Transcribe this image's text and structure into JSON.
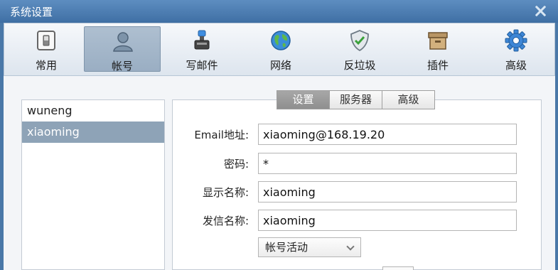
{
  "window": {
    "title": "系统设置"
  },
  "toolbar": {
    "items": [
      {
        "label": "常用",
        "icon": "switch-icon"
      },
      {
        "label": "帐号",
        "icon": "user-icon"
      },
      {
        "label": "写邮件",
        "icon": "compose-icon"
      },
      {
        "label": "网络",
        "icon": "globe-icon"
      },
      {
        "label": "反垃圾",
        "icon": "shield-icon"
      },
      {
        "label": "插件",
        "icon": "box-icon"
      },
      {
        "label": "高级",
        "icon": "gear-icon"
      }
    ],
    "active": "帐号"
  },
  "accounts": {
    "items": [
      {
        "name": "wuneng"
      },
      {
        "name": "xiaoming"
      }
    ],
    "selected": "xiaoming"
  },
  "tabs": {
    "items": [
      {
        "label": "设置"
      },
      {
        "label": "服务器"
      },
      {
        "label": "高级"
      }
    ],
    "active": "设置"
  },
  "form": {
    "email": {
      "label": "Email地址:",
      "value": "xiaoming@168.19.20"
    },
    "password": {
      "label": "密码:",
      "value": "*"
    },
    "display_name": {
      "label": "显示名称:",
      "value": "xiaoming"
    },
    "sender_name": {
      "label": "发信名称:",
      "value": "xiaoming"
    },
    "account_status": {
      "value": "帐号活动"
    }
  },
  "colors": {
    "titlebar": "#4a78a8",
    "selected_row": "#8ea3b7",
    "active_tab": "#9a9a9a"
  }
}
